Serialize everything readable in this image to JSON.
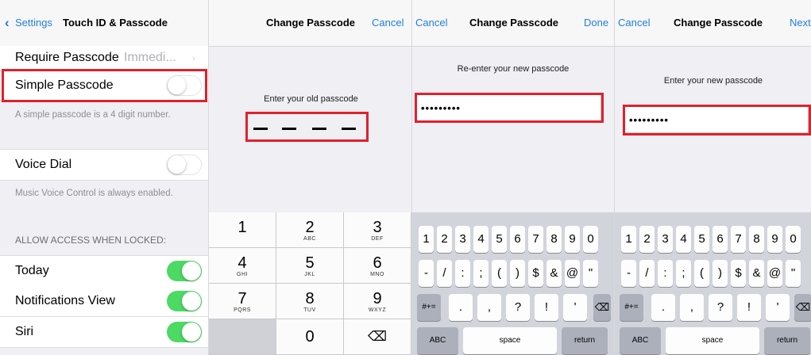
{
  "settings_panel": {
    "back_label": "Settings",
    "title": "Touch ID & Passcode",
    "require_passcode": {
      "label": "Require Passcode",
      "value": "Immedi..."
    },
    "simple_passcode": {
      "label": "Simple Passcode",
      "on": false
    },
    "simple_passcode_note": "A simple passcode is a 4 digit number.",
    "voice_dial": {
      "label": "Voice Dial",
      "on": false
    },
    "voice_dial_note": "Music Voice Control is always enabled.",
    "section_header": "ALLOW ACCESS WHEN LOCKED:",
    "items": [
      {
        "label": "Today",
        "on": true
      },
      {
        "label": "Notifications View",
        "on": true
      },
      {
        "label": "Siri",
        "on": true
      }
    ]
  },
  "old_passcode_screen": {
    "title": "Change Passcode",
    "cancel": "Cancel",
    "prompt": "Enter your old passcode",
    "keypad": [
      {
        "num": "1",
        "letters": ""
      },
      {
        "num": "2",
        "letters": "ABC"
      },
      {
        "num": "3",
        "letters": "DEF"
      },
      {
        "num": "4",
        "letters": "GHI"
      },
      {
        "num": "5",
        "letters": "JKL"
      },
      {
        "num": "6",
        "letters": "MNO"
      },
      {
        "num": "7",
        "letters": "PQRS"
      },
      {
        "num": "8",
        "letters": "TUV"
      },
      {
        "num": "9",
        "letters": "WXYZ"
      },
      {
        "num": "",
        "letters": ""
      },
      {
        "num": "0",
        "letters": ""
      },
      {
        "num": "⌫",
        "letters": ""
      }
    ]
  },
  "reenter_screen": {
    "cancel": "Cancel",
    "title": "Change Passcode",
    "done": "Done",
    "prompt": "Re-enter your new passcode",
    "value": "•••••••••"
  },
  "new_screen": {
    "cancel": "Cancel",
    "title": "Change Passcode",
    "next": "Next",
    "prompt": "Enter your new passcode",
    "value": "•••••••••"
  },
  "keyboard": {
    "row1": [
      "1",
      "2",
      "3",
      "4",
      "5",
      "6",
      "7",
      "8",
      "9",
      "0"
    ],
    "row2": [
      "-",
      "/",
      ":",
      ";",
      "(",
      ")",
      "$",
      "&",
      "@",
      "\""
    ],
    "row3_left": "#+=",
    "row3": [
      ".",
      ",",
      "?",
      "!",
      "'"
    ],
    "abc": "ABC",
    "space": "space",
    "return": "return"
  },
  "colors": {
    "accent": "#1f7fe0",
    "toggle_on": "#4cd964",
    "highlight": "#e2202b"
  }
}
